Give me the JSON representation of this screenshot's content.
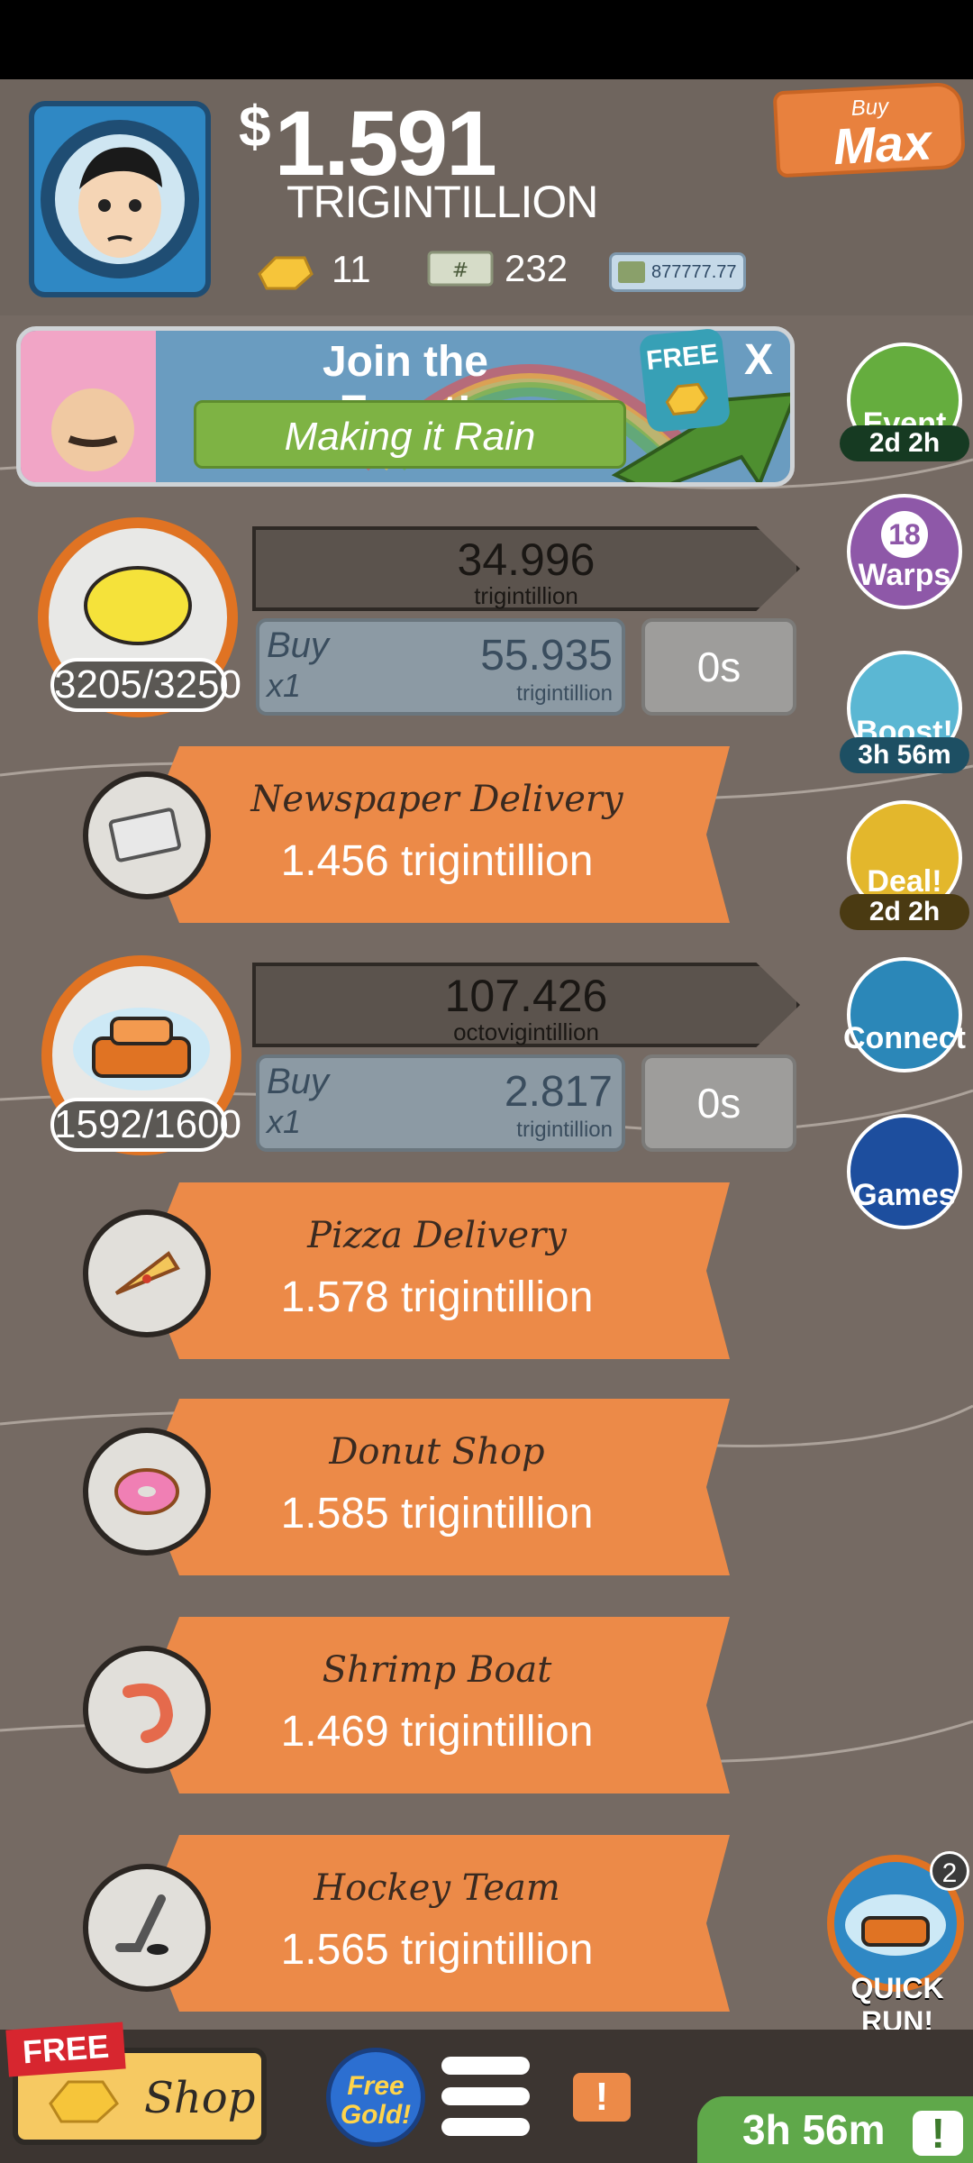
{
  "header": {
    "currency_symbol": "$",
    "money_value": "1.591",
    "money_unit": "TRIGINTILLION",
    "gold_count": "11",
    "megabucks_count": "232",
    "ticket_count": "877777.77",
    "buy_max": {
      "small": "Buy",
      "big": "Max"
    }
  },
  "event": {
    "title": "Join the Event!",
    "subtitle": "Making it Rain",
    "badge": "FREE",
    "close": "X"
  },
  "side": {
    "event": {
      "label": "Event",
      "time": "2d 2h"
    },
    "warps": {
      "count": "18",
      "label": "Warps"
    },
    "boost": {
      "label": "Boost!",
      "time": "3h 56m"
    },
    "deal": {
      "label": "Deal!",
      "time": "2d 2h"
    },
    "connect": {
      "label": "Connect"
    },
    "games": {
      "label": "Games"
    }
  },
  "businesses": {
    "lemonade": {
      "count": "3205/3250",
      "income_value": "34.996",
      "income_unit": "trigintillion",
      "buy_label": "Buy",
      "buy_mult": "x1",
      "cost_value": "55.935",
      "cost_unit": "trigintillion",
      "timer": "0s"
    },
    "car_wash": {
      "count": "1592/1600",
      "income_value": "107.426",
      "income_unit": "octovigintillion",
      "buy_label": "Buy",
      "buy_mult": "x1",
      "cost_value": "2.817",
      "cost_unit": "trigintillion",
      "timer": "0s"
    },
    "locked": [
      {
        "name": "Newspaper Delivery",
        "price": "1.456 trigintillion"
      },
      {
        "name": "Pizza Delivery",
        "price": "1.578 trigintillion"
      },
      {
        "name": "Donut Shop",
        "price": "1.585 trigintillion"
      },
      {
        "name": "Shrimp Boat",
        "price": "1.469 trigintillion"
      },
      {
        "name": "Hockey Team",
        "price": "1.565 trigintillion"
      }
    ]
  },
  "quick_run": {
    "label": "QUICK RUN!",
    "badge": "2"
  },
  "bottom": {
    "free_tag": "FREE",
    "shop_label": "Shop",
    "free_gold": "Free Gold!",
    "alert": "!",
    "timer": "3h 56m",
    "timer_icon": "!"
  }
}
